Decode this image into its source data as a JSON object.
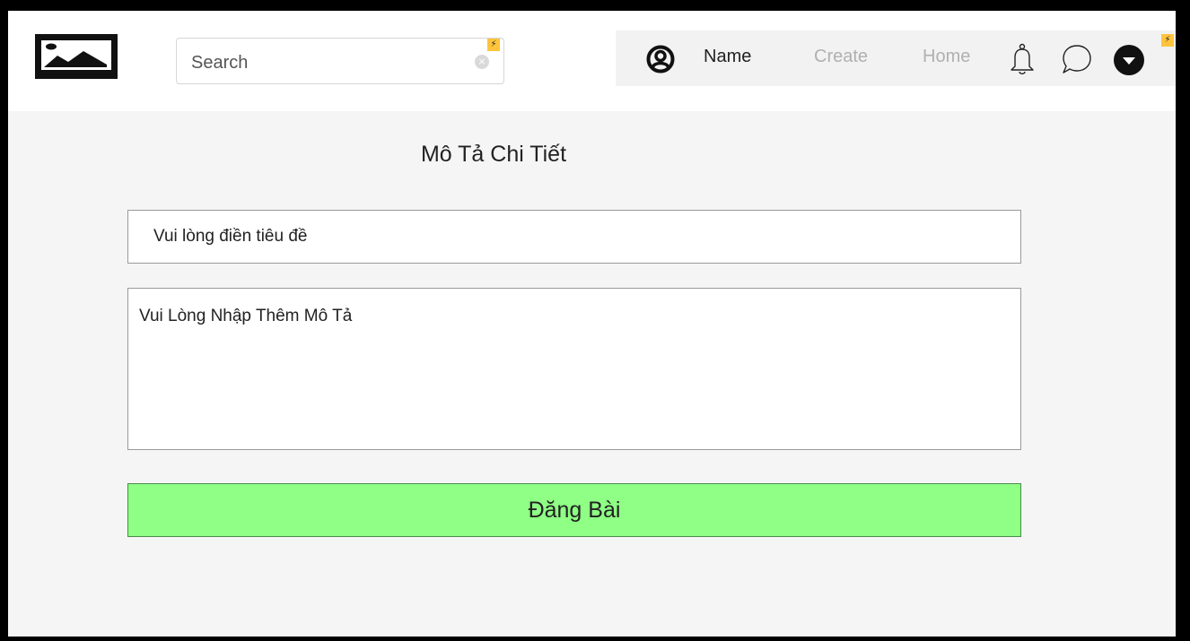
{
  "header": {
    "logo_icon": "image-placeholder-icon",
    "search": {
      "placeholder": "Search",
      "value": "",
      "clear_icon": "clear-circle-icon",
      "clear_glyph": "×"
    },
    "badge_glyph": "⚡",
    "nav": {
      "user_icon": "user-circle-icon",
      "name_label": "Name",
      "create_label": "Create",
      "home_label": "Home",
      "bell_icon": "bell-icon",
      "chat_icon": "chat-bubble-icon",
      "menu_icon": "chevron-down-circle-icon"
    }
  },
  "form": {
    "heading": "Mô Tả Chi Tiết",
    "title_field": {
      "placeholder": "Vui lòng điền tiêu đề",
      "value": ""
    },
    "description_field": {
      "placeholder": "Vui Lòng Nhập Thêm Mô Tả",
      "value": ""
    },
    "submit_label": "Đăng Bài"
  },
  "colors": {
    "background": "#f5f5f5",
    "topbar": "#ffffff",
    "nav_area": "#f2f2f2",
    "nav_active_text": "#222222",
    "nav_inactive_text": "#b0b0b0",
    "badge": "#ffc43d",
    "submit_button": "#8fff85",
    "frame_border": "#000000"
  }
}
